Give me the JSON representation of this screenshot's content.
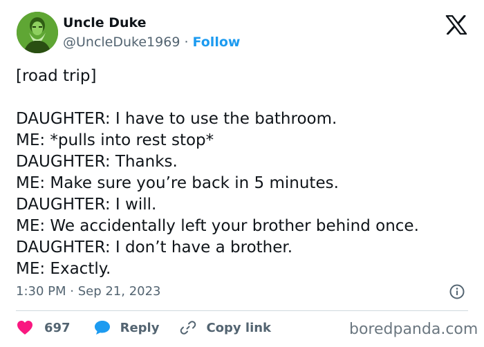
{
  "author": {
    "name": "Uncle Duke",
    "handle": "@UncleDuke1969",
    "separator": "·",
    "follow_label": "Follow"
  },
  "tweet": {
    "lines": [
      "[road trip]",
      "",
      "DAUGHTER: I have to use the bathroom.",
      "ME: *pulls into rest stop*",
      "DAUGHTER: Thanks.",
      "ME: Make sure you’re back in 5 minutes.",
      "DAUGHTER: I will.",
      "ME: We accidentally left your brother behind once.",
      "DAUGHTER: I don’t have a brother.",
      "ME: Exactly."
    ],
    "timestamp": "1:30 PM · Sep 21, 2023"
  },
  "actions": {
    "like_count": "697",
    "reply_label": "Reply",
    "copy_link_label": "Copy link"
  },
  "watermark": "boredpanda.com",
  "icons": {
    "logo": "x-logo-icon",
    "info": "info-icon",
    "like": "heart-icon",
    "reply": "speech-bubble-icon",
    "copy": "link-icon"
  },
  "colors": {
    "text": "#0f1419",
    "secondary": "#536471",
    "follow": "#1d9bf0",
    "like": "#f91880",
    "reply": "#1d9bf0",
    "avatar": "#4e8f28",
    "divider": "#cfd9de"
  }
}
